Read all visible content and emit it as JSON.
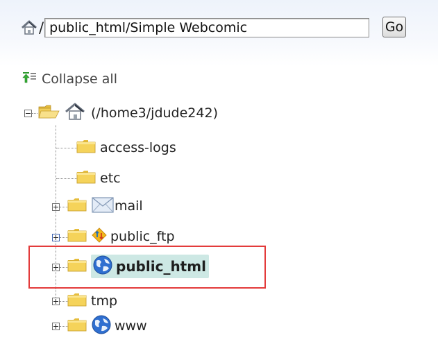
{
  "pathbar": {
    "separator": "/",
    "path_value": "public_html/Simple Webcomic",
    "go_label": "Go"
  },
  "toolbar": {
    "collapse_label": "Collapse all"
  },
  "tree": {
    "root_label": "(/home3/jdude242)",
    "items": [
      {
        "label": "access-logs",
        "icon": "folder-icon"
      },
      {
        "label": "etc",
        "icon": "folder-icon"
      },
      {
        "label": "mail",
        "icon": "mail-icon"
      },
      {
        "label": "public_ftp",
        "icon": "ftp-icon"
      },
      {
        "label": "public_html",
        "icon": "globe-icon",
        "selected": true
      },
      {
        "label": "tmp",
        "icon": "folder-icon"
      },
      {
        "label": "www",
        "icon": "globe-icon"
      }
    ]
  },
  "colors": {
    "selected_bg": "#cde8e4",
    "highlight_border": "#e33b3b",
    "folder_yellow": "#f5d35a"
  }
}
